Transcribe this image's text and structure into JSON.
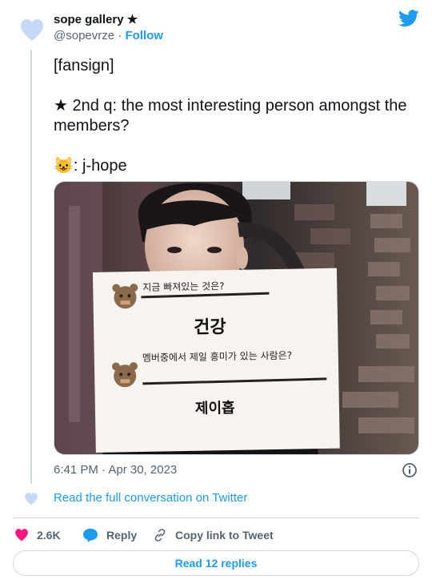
{
  "author": {
    "name": "sope gallery ★",
    "handle": "@sopevrze",
    "separator": "·",
    "follow_label": "Follow"
  },
  "tweet": {
    "text": "[fansign]\n\n★ 2nd q: the most interesting person amongst the members?\n\n😺: j-hope"
  },
  "photo": {
    "card_q1": "지금 빠져있는 것은?",
    "card_a1": "건강",
    "card_q2": "멤버중에서 제일 흥미가 있는 사람은?",
    "card_a2": "제이홉"
  },
  "meta": {
    "timestamp": "6:41 PM · Apr 30, 2023",
    "read_conversation": "Read the full conversation on Twitter"
  },
  "actions": {
    "like_count": "2.6K",
    "reply_label": "Reply",
    "copy_label": "Copy link to Tweet",
    "read_replies": "Read 12 replies"
  },
  "colors": {
    "accent": "#1d9bf0",
    "heart": "#f91880",
    "avatar_heart": "#c5d9f7",
    "muted": "#536471",
    "border": "#cfd9de"
  }
}
